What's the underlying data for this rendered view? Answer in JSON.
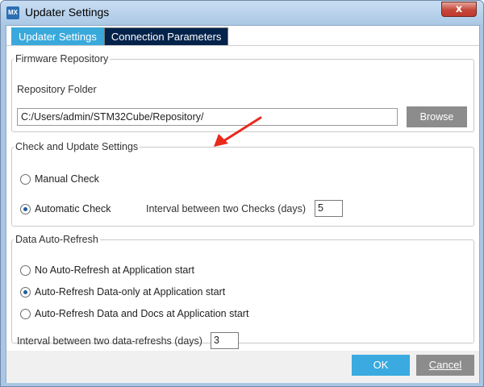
{
  "window": {
    "title": "Updater Settings",
    "app_icon_text": "MX",
    "close_glyph": "x"
  },
  "tabs": [
    {
      "label": "Updater Settings",
      "active": true
    },
    {
      "label": "Connection Parameters",
      "active": false
    }
  ],
  "firmware_repository": {
    "legend": "Firmware Repository",
    "folder_label": "Repository Folder",
    "folder_value": "C:/Users/admin/STM32Cube/Repository/",
    "browse_label": "Browse"
  },
  "check_update": {
    "legend": "Check and Update Settings",
    "options": [
      {
        "label": "Manual Check",
        "checked": false
      },
      {
        "label": "Automatic Check",
        "checked": true
      }
    ],
    "interval_label": "Interval between two Checks (days)",
    "interval_value": "5"
  },
  "auto_refresh": {
    "legend": "Data Auto-Refresh",
    "options": [
      {
        "label": "No Auto-Refresh at Application start",
        "checked": false
      },
      {
        "label": "Auto-Refresh Data-only at Application start",
        "checked": true
      },
      {
        "label": "Auto-Refresh Data and Docs at Application start",
        "checked": false
      }
    ],
    "interval_label": "Interval between two data-refreshs (days)",
    "interval_value": "3"
  },
  "footer": {
    "ok_label": "OK",
    "cancel_label": "Cancel"
  },
  "annotation": {
    "arrow_color": "#e8291c",
    "icon": "red-arrow-icon"
  },
  "colors": {
    "accent": "#39a9dc",
    "tab_inactive": "#03234b",
    "button_gray": "#8c8c8c"
  }
}
